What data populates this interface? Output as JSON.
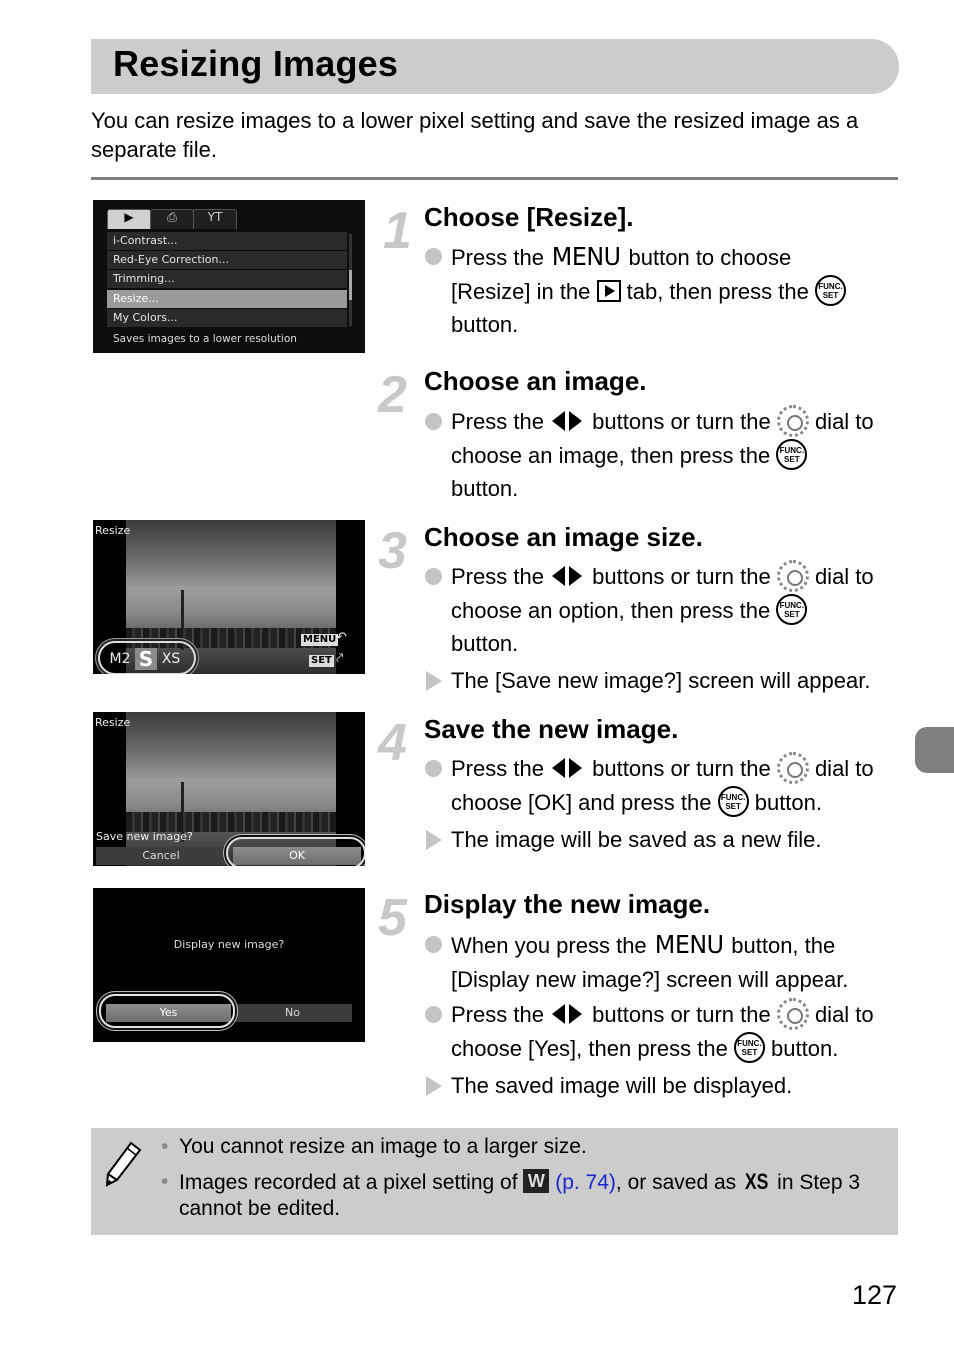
{
  "page": {
    "title": "Resizing Images",
    "intro": "You can resize images to a lower pixel setting and save the resized image as a separate file.",
    "page_number": "127",
    "accent_gray": "#cccccc"
  },
  "icons": {
    "menu_button": "MENU",
    "func_set_top": "FUNC.",
    "func_set_bottom": "SET",
    "play_tab": "play-icon",
    "left_right": "left-right-arrows-icon",
    "control_dial": "control-dial-icon"
  },
  "steps": [
    {
      "number": "1",
      "title": "Choose [Resize].",
      "bullets": [
        {
          "type": "action",
          "parts": [
            "Press the ",
            " button to choose",
            "[Resize] in the ",
            " tab, then press the ",
            "button."
          ]
        }
      ]
    },
    {
      "number": "2",
      "title": "Choose an image.",
      "bullets": [
        {
          "type": "action",
          "parts": [
            "Press the ",
            " buttons or turn the ",
            " dial to",
            "choose an image, then press the ",
            "button."
          ]
        }
      ]
    },
    {
      "number": "3",
      "title": "Choose an image size.",
      "bullets": [
        {
          "type": "action",
          "parts": [
            "Press the ",
            " buttons or turn the ",
            " dial to",
            "choose an option, then press the ",
            "button."
          ]
        },
        {
          "type": "result",
          "text": "The [Save new image?] screen will appear."
        }
      ]
    },
    {
      "number": "4",
      "title": "Save the new image.",
      "bullets": [
        {
          "type": "action",
          "parts": [
            "Press the ",
            " buttons or turn the ",
            " dial to",
            "choose [OK] and press the ",
            " button."
          ]
        },
        {
          "type": "result",
          "text": "The image will be saved as a new file."
        }
      ]
    },
    {
      "number": "5",
      "title": "Display the new image.",
      "bullets": [
        {
          "type": "action",
          "parts": [
            "When you press the ",
            " button, the",
            "[Display new image?] screen will appear."
          ]
        },
        {
          "type": "action",
          "parts": [
            "Press the ",
            " buttons or turn the ",
            " dial to",
            "choose [Yes], then press the ",
            " button."
          ]
        },
        {
          "type": "result",
          "text": "The saved image will be displayed."
        }
      ]
    }
  ],
  "screens": {
    "menu": {
      "tabs": [
        "▶",
        "⎙",
        "YT"
      ],
      "items": [
        "i-Contrast...",
        "Red-Eye Correction...",
        "Trimming...",
        "Resize...",
        "My Colors..."
      ],
      "selected_index": 3,
      "help_text": "Saves images to a lower resolution"
    },
    "size_select": {
      "label": "Resize",
      "options": [
        "M2",
        "S",
        "XS"
      ],
      "selected": "S",
      "menu_tag": "MENU",
      "set_tag": "SET",
      "back_glyph": "↶",
      "resize_glyph": "⤤"
    },
    "save_confirm": {
      "label": "Resize",
      "prompt": "Save new image?",
      "buttons": [
        "Cancel",
        "OK"
      ],
      "selected": "OK"
    },
    "display_confirm": {
      "prompt": "Display new image?",
      "buttons": [
        "Yes",
        "No"
      ],
      "selected": "Yes"
    }
  },
  "note": {
    "items": [
      {
        "text": "You cannot resize an image to a larger size."
      },
      {
        "before": "Images recorded at a pixel setting of ",
        "icon": "W",
        "link": "(p. 74)",
        "middle": ", or saved as ",
        "icon2": "XS",
        "after": " in Step 3 cannot be edited."
      }
    ]
  }
}
